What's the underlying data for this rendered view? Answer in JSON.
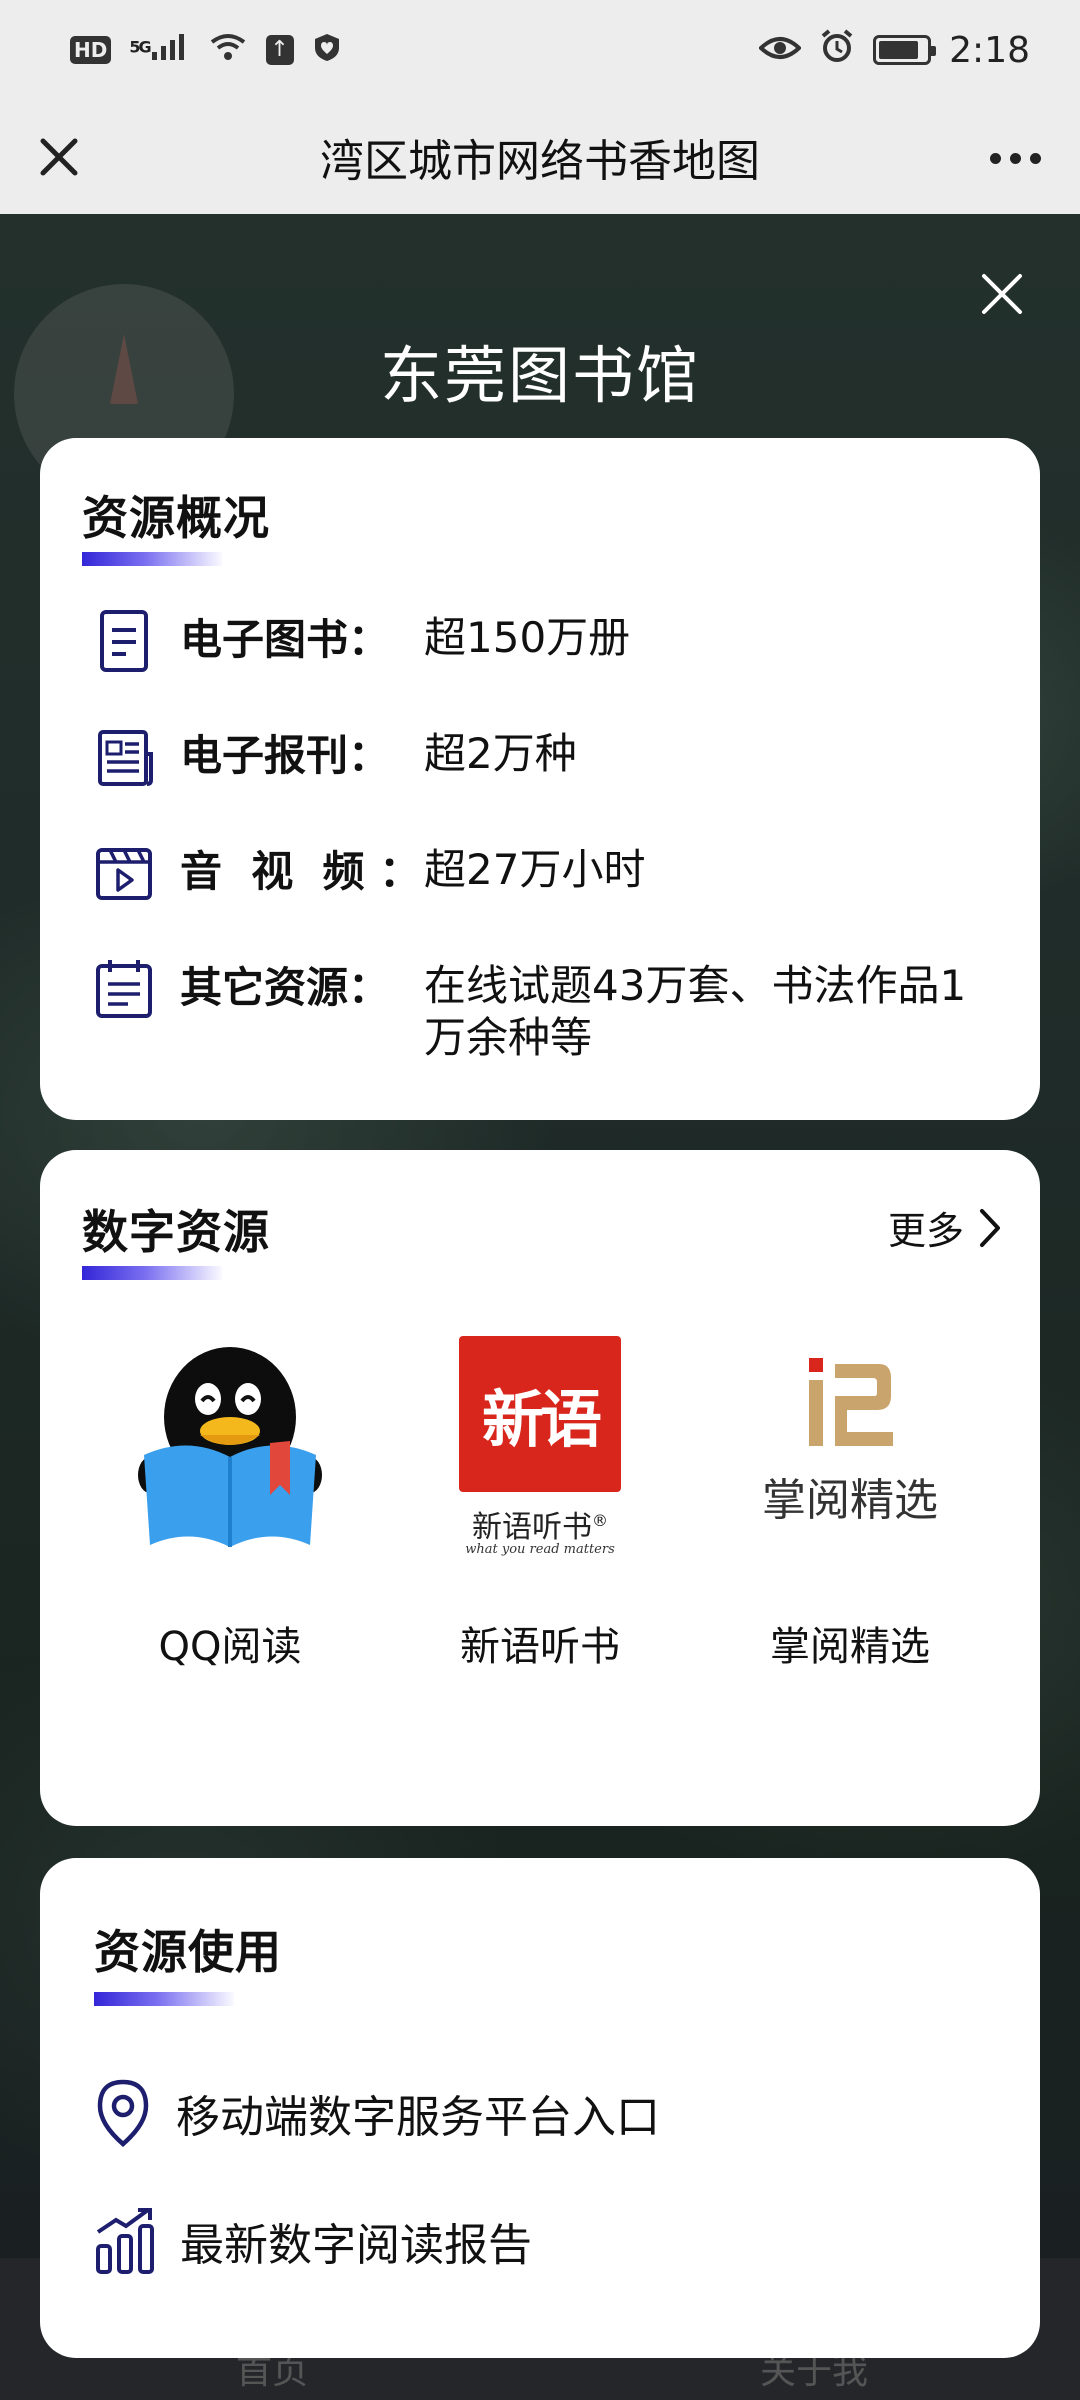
{
  "status_bar": {
    "left_icons": [
      "hd-icon",
      "5g-signal-icon",
      "wifi-icon",
      "upload-icon",
      "heart-shield-icon"
    ],
    "right_icons": [
      "eye-icon",
      "alarm-icon",
      "battery-icon"
    ],
    "hd": "HD",
    "signal": "5G",
    "time": "2:18"
  },
  "title_bar": {
    "title": "湾区城市网络书香地图"
  },
  "popup": {
    "library_name": "东莞图书馆"
  },
  "overview": {
    "title": "资源概况",
    "items": [
      {
        "icon": "document-icon",
        "label": "电子图书：",
        "value": "超150万册"
      },
      {
        "icon": "newspaper-icon",
        "label": "电子报刊：",
        "value": "超2万种"
      },
      {
        "icon": "video-icon",
        "label": "音  视  频 ：",
        "value": "超27万小时"
      },
      {
        "icon": "calendar-list-icon",
        "label": "其它资源：",
        "value": "在线试题43万套、书法作品1万余种等"
      }
    ]
  },
  "digital": {
    "title": "数字资源",
    "more_label": "更多",
    "apps": [
      {
        "name": "QQ阅读",
        "icon": "qq-reading-logo"
      },
      {
        "name": "新语听书",
        "icon": "xinyu-logo",
        "logo_cn": "新语",
        "logo_text": "新语听书",
        "logo_sub": "what you read matters",
        "reg": "®"
      },
      {
        "name": "掌阅精选",
        "icon": "zhangyue-logo",
        "logo_text": "掌阅精选"
      }
    ]
  },
  "usage": {
    "title": "资源使用",
    "items": [
      {
        "icon": "location-pin-icon",
        "label": "移动端数字服务平台入口"
      },
      {
        "icon": "bar-chart-icon",
        "label": "最新数字阅读报告"
      }
    ]
  },
  "tabbar": {
    "tab_home": "首页",
    "tab_about": "关于我"
  },
  "colors": {
    "accent": "#2a2fb8",
    "icon_navy": "#1d1f6e",
    "xinyu_red": "#d8261c",
    "qq_blue": "#3aa0ee",
    "zhangyue_gold": "#c9a56d"
  }
}
